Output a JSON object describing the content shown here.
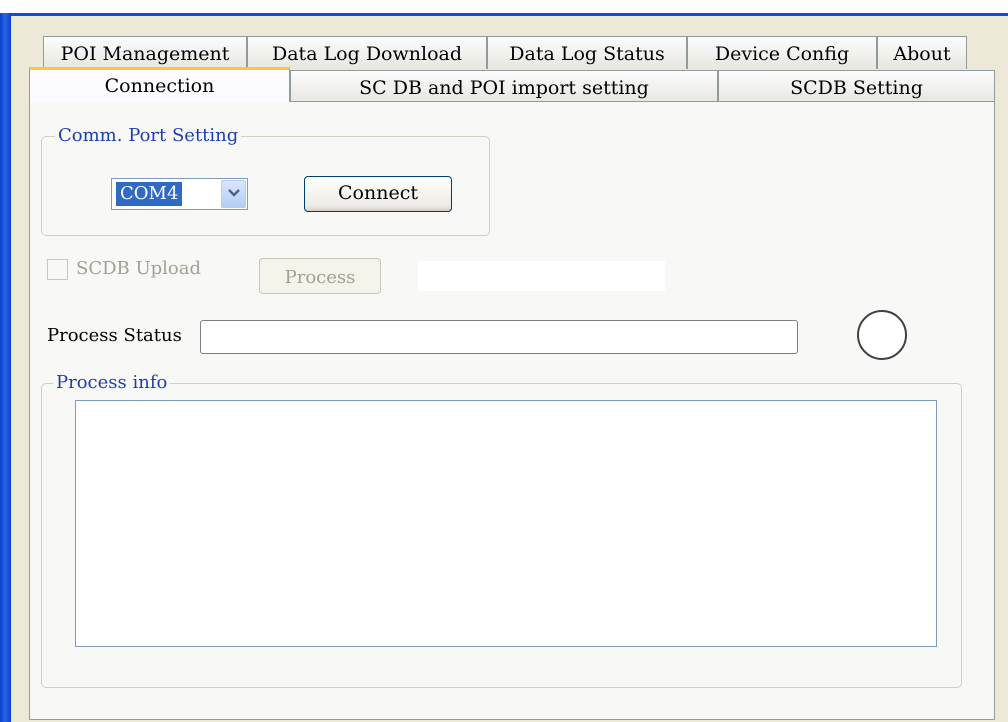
{
  "tabs_row1": [
    "POI Management",
    "Data Log Download",
    "Data Log Status",
    "Device Config",
    "About"
  ],
  "tabs_row2": [
    "Connection",
    "SC DB and POI import setting",
    "SCDB  Setting"
  ],
  "comm_port": {
    "title": "Comm. Port Setting",
    "port_value": "COM4",
    "connect_label": "Connect"
  },
  "scdb": {
    "upload_label": "SCDB Upload",
    "upload_checked": false,
    "process_label": "Process"
  },
  "status": {
    "label": "Process Status",
    "value": ""
  },
  "info": {
    "title": "Process info",
    "text": ""
  },
  "icons": {
    "dropdown": "chevron-down-icon",
    "indicator": "status-indicator-circle"
  },
  "colors": {
    "active_tab_accent": "#ffc83c",
    "group_title": "#1c3fae",
    "window_border": "#0a4fd6"
  }
}
